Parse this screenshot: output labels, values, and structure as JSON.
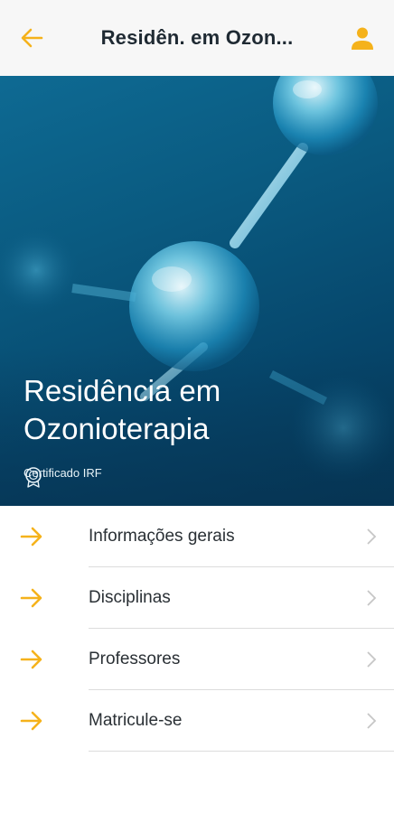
{
  "header": {
    "title": "Residên. em Ozon...",
    "back_icon": "arrow-left-icon",
    "user_icon": "person-icon",
    "accent": "#f5b21b"
  },
  "hero": {
    "title": "Residência em Ozonioterapia",
    "certificate": "Certificado IRF",
    "certificate_icon": "certificate-badge-icon"
  },
  "menu": {
    "items": [
      {
        "label": "Informações gerais",
        "icon": "arrow-right-icon"
      },
      {
        "label": "Disciplinas",
        "icon": "arrow-right-icon"
      },
      {
        "label": "Professores",
        "icon": "arrow-right-icon"
      },
      {
        "label": "Matricule-se",
        "icon": "arrow-right-icon"
      }
    ]
  }
}
